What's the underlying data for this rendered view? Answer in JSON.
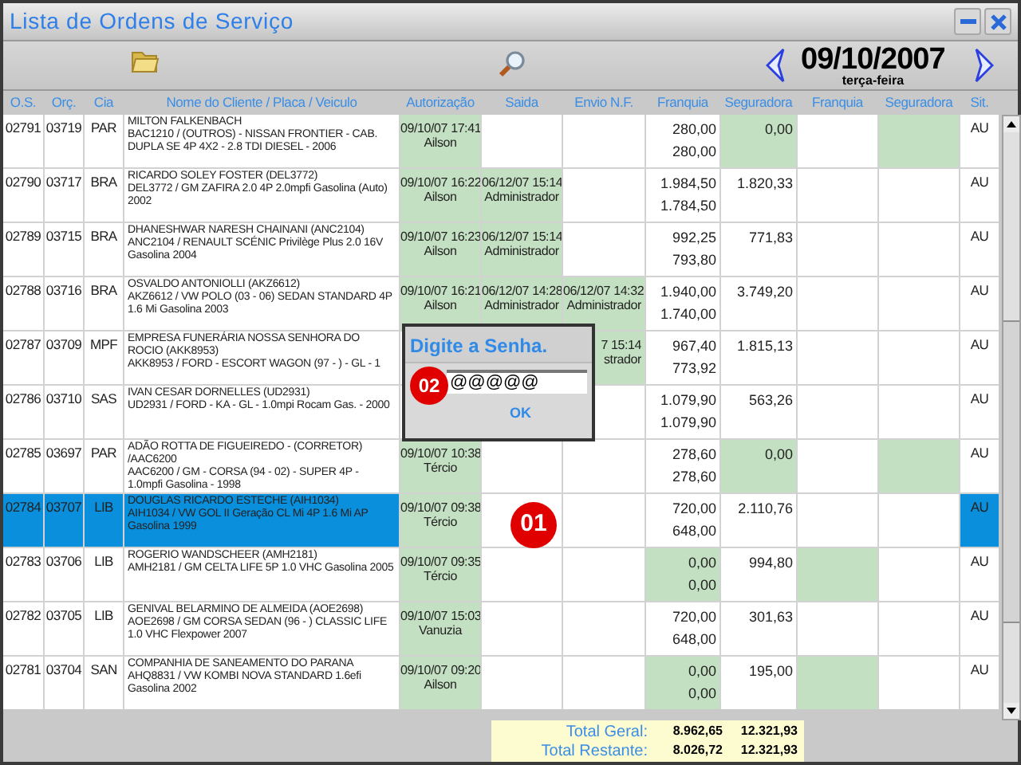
{
  "window": {
    "title": "Lista de Ordens de Serviço"
  },
  "toolbar": {
    "date": "09/10/2007",
    "weekday": "terça-feira"
  },
  "table": {
    "columns": [
      "O.S.",
      "Orç.",
      "Cia",
      "Nome do Cliente / Placa / Veiculo",
      "Autorização",
      "Saida",
      "Envio N.F.",
      "Franquia",
      "Seguradora",
      "Franquia",
      "Seguradora",
      "Sit."
    ],
    "rows": [
      {
        "os": "02791",
        "orc": "03719",
        "cia": "PAR",
        "client": "MILTON FALKENBACH",
        "vehicle": "BAC1210 / (OUTROS) - NISSAN FRONTIER - CAB. DUPLA SE 4P 4X2 - 2.8 TDI DIESEL - 2006",
        "selected": false,
        "authorization": {
          "date": "09/10/07 17:41",
          "user": "Ailson",
          "highlighted": true
        },
        "exit": {
          "highlighted": false
        },
        "invoice": {
          "highlighted": false
        },
        "franchise_1": {
          "values": [
            "280,00",
            "280,00"
          ],
          "highlighted": false
        },
        "insurer_1": {
          "value": "0,00",
          "highlighted": true
        },
        "franchise_2": {
          "highlighted": false
        },
        "insurer_2": {
          "highlighted": true
        },
        "status": "AU"
      },
      {
        "os": "02790",
        "orc": "03717",
        "cia": "BRA",
        "client": "RICARDO SOLEY FOSTER (DEL3772)",
        "vehicle": "DEL3772 / GM ZAFIRA 2.0 4P 2.0mpfi Gasolina (Auto) 2002",
        "selected": false,
        "authorization": {
          "date": "09/10/07 16:22",
          "user": "Ailson",
          "highlighted": true
        },
        "exit": {
          "date": "06/12/07 15:14",
          "user": "Administrador",
          "highlighted": true
        },
        "invoice": {
          "highlighted": false
        },
        "franchise_1": {
          "values": [
            "1.984,50",
            "1.784,50"
          ],
          "highlighted": false
        },
        "insurer_1": {
          "value": "1.820,33",
          "highlighted": false
        },
        "franchise_2": {
          "highlighted": false
        },
        "insurer_2": {
          "highlighted": false
        },
        "status": "AU"
      },
      {
        "os": "02789",
        "orc": "03715",
        "cia": "BRA",
        "client": "DHANESHWAR NARESH CHAINANI (ANC2104)",
        "vehicle": "ANC2104 / RENAULT SCÉNIC Privilège Plus 2.0 16V Gasolina 2004",
        "selected": false,
        "authorization": {
          "date": "09/10/07 16:23",
          "user": "Ailson",
          "highlighted": true
        },
        "exit": {
          "date": "06/12/07 15:14",
          "user": "Administrador",
          "highlighted": true
        },
        "invoice": {
          "highlighted": false
        },
        "franchise_1": {
          "values": [
            "992,25",
            "793,80"
          ],
          "highlighted": false
        },
        "insurer_1": {
          "value": "771,83",
          "highlighted": false
        },
        "franchise_2": {
          "highlighted": false
        },
        "insurer_2": {
          "highlighted": false
        },
        "status": "AU"
      },
      {
        "os": "02788",
        "orc": "03716",
        "cia": "BRA",
        "client": "OSVALDO ANTONIOLLI (AKZ6612)",
        "vehicle": "AKZ6612 / VW POLO (03 - 06) SEDAN STANDARD 4P 1.6 Mi Gasolina 2003",
        "selected": false,
        "authorization": {
          "date": "09/10/07 16:21",
          "user": "Ailson",
          "highlighted": true
        },
        "exit": {
          "date": "06/12/07 14:28",
          "user": "Administrador",
          "highlighted": true
        },
        "invoice": {
          "date": "06/12/07 14:32",
          "user": "Administrador",
          "highlighted": true
        },
        "franchise_1": {
          "values": [
            "1.940,00",
            "1.740,00"
          ],
          "highlighted": false
        },
        "insurer_1": {
          "value": "3.749,20",
          "highlighted": false
        },
        "franchise_2": {
          "highlighted": false
        },
        "insurer_2": {
          "highlighted": false
        },
        "status": "AU"
      },
      {
        "os": "02787",
        "orc": "03709",
        "cia": "MPF",
        "client": "EMPRESA FUNERÁRIA NOSSA SENHORA DO ROCIO (AKK8953)",
        "vehicle": "AKK8953 / FORD - ESCORT WAGON (97 - ) - GL - 1",
        "selected": false,
        "invoice": {
          "date": "7 15:14",
          "user": "strador",
          "highlighted": true
        },
        "franchise_1": {
          "values": [
            "967,40",
            "773,92"
          ],
          "highlighted": false
        },
        "insurer_1": {
          "value": "1.815,13",
          "highlighted": false
        },
        "franchise_2": {
          "highlighted": false
        },
        "insurer_2": {
          "highlighted": false
        },
        "status": "AU"
      },
      {
        "os": "02786",
        "orc": "03710",
        "cia": "SAS",
        "client": "IVAN CESAR DORNELLES (UD2931)",
        "vehicle": "UD2931 / FORD - KA - GL - 1.0mpi Rocam Gas. - 2000",
        "selected": false,
        "invoice": {
          "highlighted": false
        },
        "franchise_1": {
          "values": [
            "1.079,90",
            "1.079,90"
          ],
          "highlighted": false
        },
        "insurer_1": {
          "value": "563,26",
          "highlighted": false
        },
        "franchise_2": {
          "highlighted": false
        },
        "insurer_2": {
          "highlighted": false
        },
        "status": "AU"
      },
      {
        "os": "02785",
        "orc": "03697",
        "cia": "PAR",
        "client": "ADÃO ROTTA DE FIGUEIREDO - (CORRETOR) /AAC6200",
        "vehicle": "AAC6200 / GM - CORSA (94 - 02) - SUPER 4P - 1.0mpfi Gasolina - 1998",
        "selected": false,
        "authorization": {
          "date": "09/10/07 10:38",
          "user": "Tércio",
          "highlighted": true
        },
        "exit": {
          "highlighted": false
        },
        "invoice": {
          "highlighted": false
        },
        "franchise_1": {
          "values": [
            "278,60",
            "278,60"
          ],
          "highlighted": false
        },
        "insurer_1": {
          "value": "0,00",
          "highlighted": true
        },
        "franchise_2": {
          "highlighted": false
        },
        "insurer_2": {
          "highlighted": true
        },
        "status": "AU"
      },
      {
        "os": "02784",
        "orc": "03707",
        "cia": "LIB",
        "client": "DOUGLAS RICARDO ESTECHE (AIH1034)",
        "vehicle": "AIH1034 / VW GOL II Geração CL Mi 4P 1.6 Mi AP Gasolina 1999",
        "selected": true,
        "authorization": {
          "date": "09/10/07 09:38",
          "user": "Tércio",
          "highlighted": true
        },
        "exit": {
          "highlighted": false
        },
        "invoice": {
          "highlighted": false
        },
        "franchise_1": {
          "values": [
            "720,00",
            "648,00"
          ],
          "highlighted": false
        },
        "insurer_1": {
          "value": "2.110,76",
          "highlighted": false
        },
        "franchise_2": {
          "highlighted": false
        },
        "insurer_2": {
          "highlighted": false
        },
        "status": "AU"
      },
      {
        "os": "02783",
        "orc": "03706",
        "cia": "LIB",
        "client": "ROGERIO WANDSCHEER (AMH2181)",
        "vehicle": "AMH2181 / GM CELTA LIFE 5P 1.0 VHC Gasolina 2005",
        "selected": false,
        "authorization": {
          "date": "09/10/07 09:35",
          "user": "Tércio",
          "highlighted": true
        },
        "exit": {
          "highlighted": false
        },
        "invoice": {
          "highlighted": false
        },
        "franchise_1": {
          "values": [
            "0,00",
            "0,00"
          ],
          "highlighted": true
        },
        "insurer_1": {
          "value": "994,80",
          "highlighted": false
        },
        "franchise_2": {
          "highlighted": true
        },
        "insurer_2": {
          "highlighted": false
        },
        "status": "AU"
      },
      {
        "os": "02782",
        "orc": "03705",
        "cia": "LIB",
        "client": "GENIVAL BELARMINO DE ALMEIDA (AOE2698)",
        "vehicle": "AOE2698 / GM CORSA SEDAN (96 - ) CLASSIC LIFE 1.0 VHC Flexpower 2007",
        "selected": false,
        "authorization": {
          "date": "09/10/07 15:03",
          "user": "Vanuzia",
          "highlighted": true
        },
        "exit": {
          "highlighted": false
        },
        "invoice": {
          "highlighted": false
        },
        "franchise_1": {
          "values": [
            "720,00",
            "648,00"
          ],
          "highlighted": false
        },
        "insurer_1": {
          "value": "301,63",
          "highlighted": false
        },
        "franchise_2": {
          "highlighted": false
        },
        "insurer_2": {
          "highlighted": false
        },
        "status": "AU"
      },
      {
        "os": "02781",
        "orc": "03704",
        "cia": "SAN",
        "client": "COMPANHIA DE SANEAMENTO DO PARANA",
        "vehicle": "AHQ8831 / VW KOMBI NOVA STANDARD 1.6efi Gasolina 2002",
        "selected": false,
        "authorization": {
          "date": "09/10/07 09:20",
          "user": "Ailson",
          "highlighted": true
        },
        "exit": {
          "highlighted": false
        },
        "invoice": {
          "highlighted": false
        },
        "franchise_1": {
          "values": [
            "0,00",
            "0,00"
          ],
          "highlighted": true
        },
        "insurer_1": {
          "value": "195,00",
          "highlighted": false
        },
        "franchise_2": {
          "highlighted": true
        },
        "insurer_2": {
          "highlighted": false
        },
        "status": "AU"
      }
    ]
  },
  "totals": [
    {
      "label": "Total Geral:",
      "franchise": "8.962,65",
      "insurer": "12.321,93"
    },
    {
      "label": "Total Restante:",
      "franchise": "8.026,72",
      "insurer": "12.321,93"
    }
  ],
  "dialog": {
    "title": "Digite a Senha.",
    "value": "@@@@@",
    "button": "OK"
  },
  "markers": [
    {
      "label": "01"
    },
    {
      "label": "02"
    }
  ]
}
